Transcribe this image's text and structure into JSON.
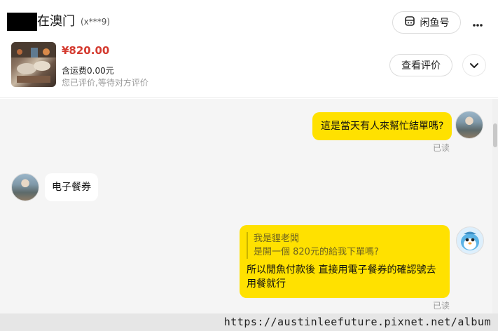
{
  "header": {
    "title": "在澳门",
    "title_sub": "(x***9)",
    "xianyu_label": "闲鱼号",
    "review_label": "查看评价"
  },
  "product": {
    "price": "¥820.00",
    "shipping": "含运费0.00元",
    "status": "您已评价,等待对方评价"
  },
  "messages": [
    {
      "side": "right",
      "text": "這是當天有人來幫忙結單嗎?",
      "read": "已读"
    },
    {
      "side": "left",
      "text": "电子餐券"
    },
    {
      "side": "right",
      "quote_line1": "我是貍老闆",
      "quote_line2": "是開一個 820元的給我下單嗎?",
      "text_line1": "所以閒魚付款後 直接用電子餐券的確認號去",
      "text_line2": "用餐就行",
      "read": "已读"
    }
  ],
  "watermark": "https://austinleefuture.pixnet.net/album",
  "colors": {
    "bubble_mine": "#ffe100",
    "price": "#d43a2f",
    "chat_bg": "#f5f5f5"
  },
  "icons": [
    "xianyu-icon",
    "more-icon",
    "chevron-down-icon"
  ]
}
